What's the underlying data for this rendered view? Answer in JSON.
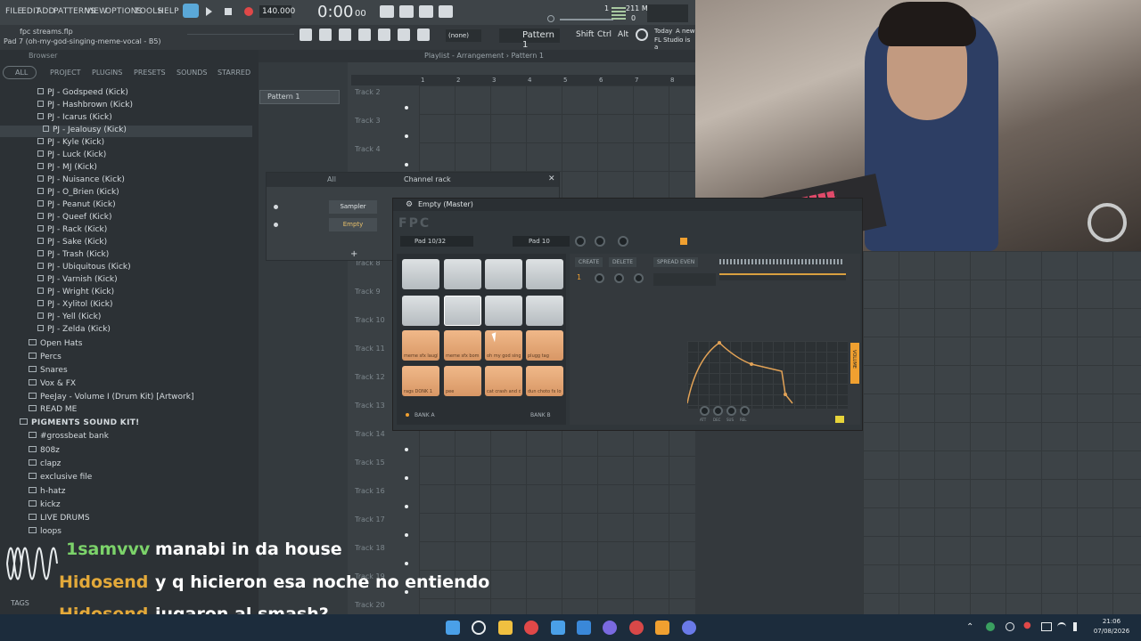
{
  "menu": {
    "items": [
      "FILE",
      "EDIT",
      "ADD",
      "PATTERNS",
      "VIEW",
      "OPTIONS",
      "TOOLS",
      "HELP"
    ]
  },
  "transport": {
    "tempo": "140.000",
    "time": "0:00",
    "time_frac": "00",
    "memory": "211 MB",
    "cpu": "1",
    "voices": "0"
  },
  "hint": {
    "file": "fpc streams.flp",
    "pad": "Pad 7 (oh-my-god-singing-meme-vocal - B5)"
  },
  "toolbar": {
    "snap": "(none)",
    "pattern": "Pattern 1",
    "shift": "Shift",
    "ctrl": "Ctrl",
    "alt": "Alt",
    "news_date": "Today",
    "news_title": "A new",
    "news_sub": "FL Studio is a"
  },
  "browser": {
    "title": "Browser",
    "tabs": [
      "ALL",
      "PROJECT",
      "PLUGINS",
      "PRESETS",
      "SOUNDS",
      "STARRED"
    ],
    "kicks": [
      "PJ - Godspeed (Kick)",
      "PJ - Hashbrown (Kick)",
      "PJ - Icarus (Kick)",
      "PJ - Jealousy (Kick)",
      "PJ - Kyle (Kick)",
      "PJ - Luck (Kick)",
      "PJ - MJ (Kick)",
      "PJ - Nuisance (Kick)",
      "PJ - O_Brien (Kick)",
      "PJ - Peanut (Kick)",
      "PJ - Queef (Kick)",
      "PJ - Rack (Kick)",
      "PJ - Sake (Kick)",
      "PJ - Trash (Kick)",
      "PJ - Ubiquitous (Kick)",
      "PJ - Varnish (Kick)",
      "PJ - Wright (Kick)",
      "PJ - Xylitol (Kick)",
      "PJ - Yell (Kick)",
      "PJ - Zelda (Kick)"
    ],
    "folders": [
      "Open Hats",
      "Percs",
      "Snares",
      "Vox & FX",
      "PeeJay - Volume I (Drum Kit) [Artwork]",
      "READ ME"
    ],
    "pack": "PIGMENTS SOUND KIT!",
    "pack_folders": [
      "#grossbeat bank",
      "808z",
      "clapz",
      "exclusive file",
      "h-hatz",
      "kickz",
      "LIVE DRUMS",
      "loops"
    ],
    "tags": "TAGS"
  },
  "playlist": {
    "breadcrumb": "Playlist - Arrangement › Pattern 1",
    "pattern_item": "Pattern 1",
    "bar_numbers": [
      "1",
      "2",
      "3",
      "4",
      "5",
      "6",
      "7",
      "8"
    ],
    "tracks": [
      "Track 2",
      "Track 3",
      "Track 4",
      "Track 8",
      "Track 9",
      "Track 10",
      "Track 11",
      "Track 12",
      "Track 13",
      "Track 14",
      "Track 15",
      "Track 16",
      "Track 17",
      "Track 18",
      "Track 19",
      "Track 20"
    ]
  },
  "channel_rack": {
    "title": "Channel rack",
    "filter": "All",
    "channels": [
      "Sampler",
      "Empty"
    ]
  },
  "fpc": {
    "title": "Empty (Master)",
    "pad_index": "Pad 10/32",
    "pad_name": "Pad 10",
    "buttons": [
      "CREATE",
      "DELETE",
      "SPREAD EVEN"
    ],
    "bank_a": "BANK A",
    "bank_b": "BANK B",
    "layer_num": "1",
    "env_label": "VOLUME",
    "env_knobs": [
      "ATT",
      "DEC",
      "SUS",
      "REL"
    ],
    "pad_labels": [
      "",
      "",
      "",
      "",
      "",
      "",
      "",
      "",
      "meme sfx laugh",
      "meme sfx bom",
      "oh my god singi",
      "plugg tag",
      "rags DONK 1",
      "pee",
      "cat crash and di",
      "dun choto fx loud"
    ]
  },
  "chat": [
    {
      "user": "1samvvv",
      "message": "manabi in da house",
      "color": "#7cd36a"
    },
    {
      "user": "Hidosend",
      "message": "y q hicieron esa noche no entiendo",
      "color": "#e3a93a"
    },
    {
      "user": "Hidosend",
      "message": "jugaron al smash?",
      "color": "#e3a93a"
    }
  ],
  "taskbar": {
    "time": "21:06",
    "date": "07/08/2026"
  },
  "colors": {
    "accent_orange": "#f0a030",
    "accent_green": "#7cd36a",
    "pad_orange": "#e8a877"
  }
}
